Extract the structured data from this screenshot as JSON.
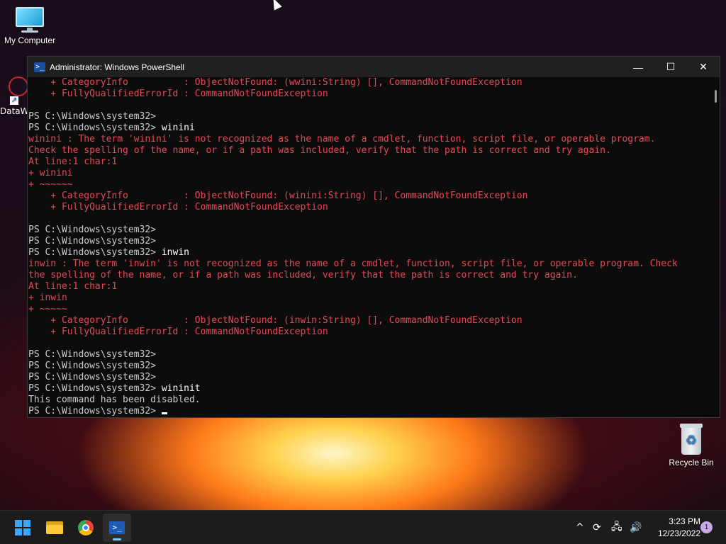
{
  "desktop": {
    "my_computer_label": "My Computer",
    "datawin_label": "DataW",
    "recycle_bin_label": "Recycle Bin"
  },
  "window": {
    "title": "Administrator: Windows PowerShell",
    "minimize_glyph": "—",
    "maximize_glyph": "☐",
    "close_glyph": "✕"
  },
  "console": {
    "lines": [
      {
        "kind": "err",
        "text": "    + CategoryInfo          : ObjectNotFound: (wwini:String) [], CommandNotFoundException"
      },
      {
        "kind": "err",
        "text": "    + FullyQualifiedErrorId : CommandNotFoundException"
      },
      {
        "kind": "out",
        "text": ""
      },
      {
        "kind": "out",
        "text": "PS C:\\Windows\\system32>"
      },
      {
        "kind": "prompt",
        "text": "PS C:\\Windows\\system32> ",
        "cmd": "winini"
      },
      {
        "kind": "err",
        "text": "winini : The term 'winini' is not recognized as the name of a cmdlet, function, script file, or operable program."
      },
      {
        "kind": "err",
        "text": "Check the spelling of the name, or if a path was included, verify that the path is correct and try again."
      },
      {
        "kind": "err",
        "text": "At line:1 char:1"
      },
      {
        "kind": "err",
        "text": "+ winini"
      },
      {
        "kind": "err",
        "text": "+ ~~~~~~"
      },
      {
        "kind": "err",
        "text": "    + CategoryInfo          : ObjectNotFound: (winini:String) [], CommandNotFoundException"
      },
      {
        "kind": "err",
        "text": "    + FullyQualifiedErrorId : CommandNotFoundException"
      },
      {
        "kind": "out",
        "text": ""
      },
      {
        "kind": "out",
        "text": "PS C:\\Windows\\system32>"
      },
      {
        "kind": "out",
        "text": "PS C:\\Windows\\system32>"
      },
      {
        "kind": "prompt",
        "text": "PS C:\\Windows\\system32> ",
        "cmd": "inwin"
      },
      {
        "kind": "err",
        "text": "inwin : The term 'inwin' is not recognized as the name of a cmdlet, function, script file, or operable program. Check"
      },
      {
        "kind": "err",
        "text": "the spelling of the name, or if a path was included, verify that the path is correct and try again."
      },
      {
        "kind": "err",
        "text": "At line:1 char:1"
      },
      {
        "kind": "err",
        "text": "+ inwin"
      },
      {
        "kind": "err",
        "text": "+ ~~~~~"
      },
      {
        "kind": "err",
        "text": "    + CategoryInfo          : ObjectNotFound: (inwin:String) [], CommandNotFoundException"
      },
      {
        "kind": "err",
        "text": "    + FullyQualifiedErrorId : CommandNotFoundException"
      },
      {
        "kind": "out",
        "text": ""
      },
      {
        "kind": "out",
        "text": "PS C:\\Windows\\system32>"
      },
      {
        "kind": "out",
        "text": "PS C:\\Windows\\system32>"
      },
      {
        "kind": "out",
        "text": "PS C:\\Windows\\system32>"
      },
      {
        "kind": "prompt",
        "text": "PS C:\\Windows\\system32> ",
        "cmd": "wininit"
      },
      {
        "kind": "out",
        "text": "This command has been disabled."
      },
      {
        "kind": "current",
        "text": "PS C:\\Windows\\system32> "
      }
    ]
  },
  "taskbar": {
    "clock_time": "3:23 PM",
    "clock_date": "12/23/2022",
    "notification_count": "1",
    "tray_chevron": "^"
  },
  "colors": {
    "console_bg": "#0c0c0c",
    "error_red": "#e74856",
    "output_gray": "#cccccc",
    "accent_blue": "#3aa6ff"
  }
}
